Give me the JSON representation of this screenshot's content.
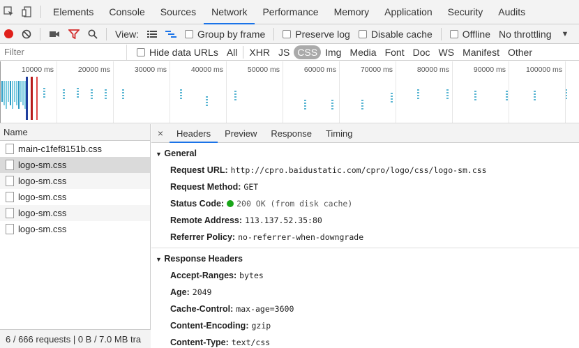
{
  "tabs": [
    "Elements",
    "Console",
    "Sources",
    "Network",
    "Performance",
    "Memory",
    "Application",
    "Security",
    "Audits"
  ],
  "active_tab": "Network",
  "toolbar": {
    "view_label": "View:",
    "group_by_frame": "Group by frame",
    "preserve_log": "Preserve log",
    "disable_cache": "Disable cache",
    "offline": "Offline",
    "throttling": "No throttling"
  },
  "filter": {
    "placeholder": "Filter",
    "hide_data_urls": "Hide data URLs",
    "types": [
      "All",
      "XHR",
      "JS",
      "CSS",
      "Img",
      "Media",
      "Font",
      "Doc",
      "WS",
      "Manifest",
      "Other"
    ],
    "active_type": "CSS"
  },
  "overview": {
    "ticks": [
      "10000 ms",
      "20000 ms",
      "30000 ms",
      "40000 ms",
      "50000 ms",
      "60000 ms",
      "70000 ms",
      "80000 ms",
      "90000 ms",
      "100000 ms"
    ]
  },
  "requests": {
    "header": "Name",
    "items": [
      "main-c1fef8151b.css",
      "logo-sm.css",
      "logo-sm.css",
      "logo-sm.css",
      "logo-sm.css",
      "logo-sm.css"
    ],
    "selected_index": 1,
    "status": "6 / 666 requests  |  0 B / 7.0 MB tra"
  },
  "detail": {
    "close": "×",
    "tabs": [
      "Headers",
      "Preview",
      "Response",
      "Timing"
    ],
    "active_tab": "Headers",
    "general_title": "General",
    "general": [
      {
        "k": "Request URL:",
        "v": "http://cpro.baidustatic.com/cpro/logo/css/logo-sm.css"
      },
      {
        "k": "Request Method:",
        "v": "GET"
      },
      {
        "k": "Status Code:",
        "v": "200 OK (from disk cache)"
      },
      {
        "k": "Remote Address:",
        "v": "113.137.52.35:80"
      },
      {
        "k": "Referrer Policy:",
        "v": "no-referrer-when-downgrade"
      }
    ],
    "response_title": "Response Headers",
    "response": [
      {
        "k": "Accept-Ranges:",
        "v": "bytes"
      },
      {
        "k": "Age:",
        "v": "2049"
      },
      {
        "k": "Cache-Control:",
        "v": "max-age=3600"
      },
      {
        "k": "Content-Encoding:",
        "v": "gzip"
      },
      {
        "k": "Content-Type:",
        "v": "text/css"
      }
    ]
  },
  "colors": {
    "accent": "#1a73e8",
    "record": "#e0201b",
    "filter_icon": "#d32f2f",
    "status_ok": "#1aa61a"
  }
}
